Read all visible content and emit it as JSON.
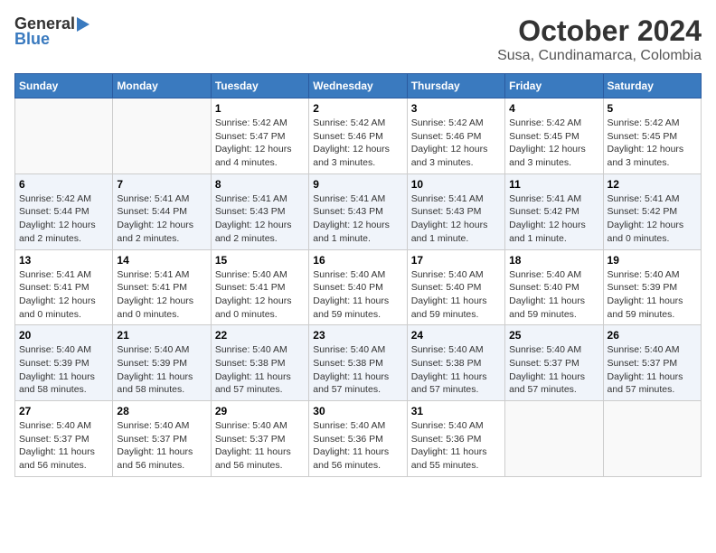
{
  "header": {
    "logo_general": "General",
    "logo_blue": "Blue",
    "title": "October 2024",
    "subtitle": "Susa, Cundinamarca, Colombia"
  },
  "weekdays": [
    "Sunday",
    "Monday",
    "Tuesday",
    "Wednesday",
    "Thursday",
    "Friday",
    "Saturday"
  ],
  "weeks": [
    [
      {
        "day": "",
        "info": ""
      },
      {
        "day": "",
        "info": ""
      },
      {
        "day": "1",
        "info": "Sunrise: 5:42 AM\nSunset: 5:47 PM\nDaylight: 12 hours and 4 minutes."
      },
      {
        "day": "2",
        "info": "Sunrise: 5:42 AM\nSunset: 5:46 PM\nDaylight: 12 hours and 3 minutes."
      },
      {
        "day": "3",
        "info": "Sunrise: 5:42 AM\nSunset: 5:46 PM\nDaylight: 12 hours and 3 minutes."
      },
      {
        "day": "4",
        "info": "Sunrise: 5:42 AM\nSunset: 5:45 PM\nDaylight: 12 hours and 3 minutes."
      },
      {
        "day": "5",
        "info": "Sunrise: 5:42 AM\nSunset: 5:45 PM\nDaylight: 12 hours and 3 minutes."
      }
    ],
    [
      {
        "day": "6",
        "info": "Sunrise: 5:42 AM\nSunset: 5:44 PM\nDaylight: 12 hours and 2 minutes."
      },
      {
        "day": "7",
        "info": "Sunrise: 5:41 AM\nSunset: 5:44 PM\nDaylight: 12 hours and 2 minutes."
      },
      {
        "day": "8",
        "info": "Sunrise: 5:41 AM\nSunset: 5:43 PM\nDaylight: 12 hours and 2 minutes."
      },
      {
        "day": "9",
        "info": "Sunrise: 5:41 AM\nSunset: 5:43 PM\nDaylight: 12 hours and 1 minute."
      },
      {
        "day": "10",
        "info": "Sunrise: 5:41 AM\nSunset: 5:43 PM\nDaylight: 12 hours and 1 minute."
      },
      {
        "day": "11",
        "info": "Sunrise: 5:41 AM\nSunset: 5:42 PM\nDaylight: 12 hours and 1 minute."
      },
      {
        "day": "12",
        "info": "Sunrise: 5:41 AM\nSunset: 5:42 PM\nDaylight: 12 hours and 0 minutes."
      }
    ],
    [
      {
        "day": "13",
        "info": "Sunrise: 5:41 AM\nSunset: 5:41 PM\nDaylight: 12 hours and 0 minutes."
      },
      {
        "day": "14",
        "info": "Sunrise: 5:41 AM\nSunset: 5:41 PM\nDaylight: 12 hours and 0 minutes."
      },
      {
        "day": "15",
        "info": "Sunrise: 5:40 AM\nSunset: 5:41 PM\nDaylight: 12 hours and 0 minutes."
      },
      {
        "day": "16",
        "info": "Sunrise: 5:40 AM\nSunset: 5:40 PM\nDaylight: 11 hours and 59 minutes."
      },
      {
        "day": "17",
        "info": "Sunrise: 5:40 AM\nSunset: 5:40 PM\nDaylight: 11 hours and 59 minutes."
      },
      {
        "day": "18",
        "info": "Sunrise: 5:40 AM\nSunset: 5:40 PM\nDaylight: 11 hours and 59 minutes."
      },
      {
        "day": "19",
        "info": "Sunrise: 5:40 AM\nSunset: 5:39 PM\nDaylight: 11 hours and 59 minutes."
      }
    ],
    [
      {
        "day": "20",
        "info": "Sunrise: 5:40 AM\nSunset: 5:39 PM\nDaylight: 11 hours and 58 minutes."
      },
      {
        "day": "21",
        "info": "Sunrise: 5:40 AM\nSunset: 5:39 PM\nDaylight: 11 hours and 58 minutes."
      },
      {
        "day": "22",
        "info": "Sunrise: 5:40 AM\nSunset: 5:38 PM\nDaylight: 11 hours and 57 minutes."
      },
      {
        "day": "23",
        "info": "Sunrise: 5:40 AM\nSunset: 5:38 PM\nDaylight: 11 hours and 57 minutes."
      },
      {
        "day": "24",
        "info": "Sunrise: 5:40 AM\nSunset: 5:38 PM\nDaylight: 11 hours and 57 minutes."
      },
      {
        "day": "25",
        "info": "Sunrise: 5:40 AM\nSunset: 5:37 PM\nDaylight: 11 hours and 57 minutes."
      },
      {
        "day": "26",
        "info": "Sunrise: 5:40 AM\nSunset: 5:37 PM\nDaylight: 11 hours and 57 minutes."
      }
    ],
    [
      {
        "day": "27",
        "info": "Sunrise: 5:40 AM\nSunset: 5:37 PM\nDaylight: 11 hours and 56 minutes."
      },
      {
        "day": "28",
        "info": "Sunrise: 5:40 AM\nSunset: 5:37 PM\nDaylight: 11 hours and 56 minutes."
      },
      {
        "day": "29",
        "info": "Sunrise: 5:40 AM\nSunset: 5:37 PM\nDaylight: 11 hours and 56 minutes."
      },
      {
        "day": "30",
        "info": "Sunrise: 5:40 AM\nSunset: 5:36 PM\nDaylight: 11 hours and 56 minutes."
      },
      {
        "day": "31",
        "info": "Sunrise: 5:40 AM\nSunset: 5:36 PM\nDaylight: 11 hours and 55 minutes."
      },
      {
        "day": "",
        "info": ""
      },
      {
        "day": "",
        "info": ""
      }
    ]
  ]
}
